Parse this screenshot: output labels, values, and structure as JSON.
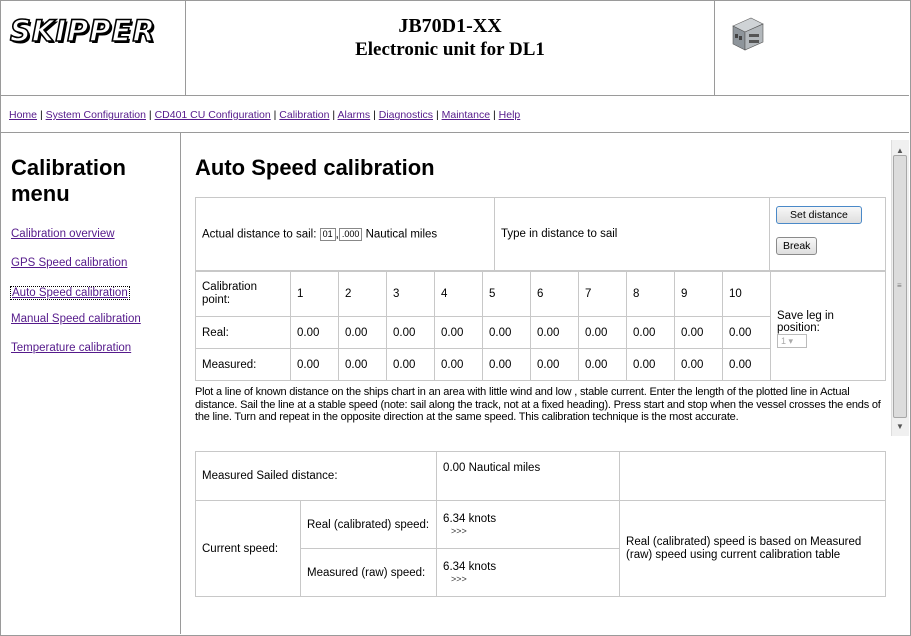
{
  "header": {
    "logo_text": "SKIPPER",
    "title": "JB70D1-XX",
    "subtitle": "Electronic unit for DL1",
    "device_icon": "electronic-unit-image"
  },
  "nav": {
    "links": [
      "Home",
      "System Configuration",
      "CD401 CU Configuration",
      "Calibration",
      "Alarms",
      "Diagnostics",
      "Maintance",
      "Help"
    ],
    "separator": "|"
  },
  "sidebar": {
    "title": "Calibration menu",
    "items": [
      {
        "label": "Calibration overview"
      },
      {
        "label": "GPS Speed calibration"
      },
      {
        "label": "Auto Speed calibration"
      },
      {
        "label": "Manual Speed calibration"
      },
      {
        "label": "Temperature calibration"
      }
    ]
  },
  "main": {
    "title": "Auto Speed calibration",
    "distance": {
      "label": "Actual distance to sail:",
      "whole": "01",
      "separator": ",",
      "fraction": ".000",
      "unit": "Nautical miles",
      "hint": "Type in distance to sail",
      "set_button": "Set distance",
      "break_button": "Break"
    },
    "points_table": {
      "header_label": "Calibration point:",
      "points": [
        "1",
        "2",
        "3",
        "4",
        "5",
        "6",
        "7",
        "8",
        "9",
        "10"
      ],
      "real_label": "Real:",
      "real": [
        "0.00",
        "0.00",
        "0.00",
        "0.00",
        "0.00",
        "0.00",
        "0.00",
        "0.00",
        "0.00",
        "0.00"
      ],
      "measured_label": "Measured:",
      "measured": [
        "0.00",
        "0.00",
        "0.00",
        "0.00",
        "0.00",
        "0.00",
        "0.00",
        "0.00",
        "0.00",
        "0.00"
      ],
      "save_leg_label": "Save leg in position:",
      "save_leg_value": "1"
    },
    "description": "Plot a line of known distance on the ships chart in an area with little wind and low , stable current. Enter the length of the plotted line in Actual distance. Sail the line at a stable speed (note: sail along the track, not at a fixed heading). Press start and stop when the vessel crosses the ends of the line. Turn and repeat in the opposite direction at the same speed. This calibration technique is the most accurate.",
    "results": {
      "sailed_label": "Measured Sailed distance:",
      "sailed_value": "0.00 Nautical miles",
      "current_speed_label": "Current speed:",
      "real_speed_label": "Real (calibrated) speed:",
      "real_speed_value": "6.34 knots",
      "measured_speed_label": "Measured (raw) speed:",
      "measured_speed_value": "6.34 knots",
      "arrows": ">>>",
      "note": "Real (calibrated) speed is based on Measured (raw) speed using current calibration table"
    }
  }
}
